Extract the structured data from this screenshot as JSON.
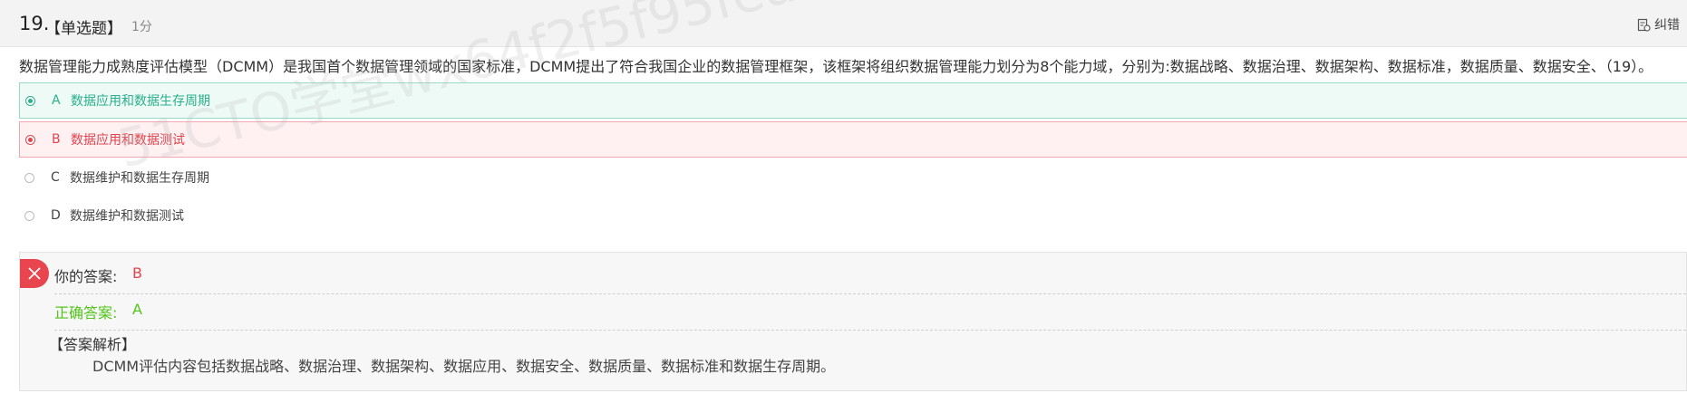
{
  "question": {
    "number": "19.",
    "type": "【单选题】",
    "score": "1分",
    "report_label": "纠错",
    "stem": "数据管理能力成熟度评估模型（DCMM）是我国首个数据管理领域的国家标准，DCMM提出了符合我国企业的数据管理框架，该框架将组织数据管理能力划分为8个能力域，分别为:数据战略、数据治理、数据架构、数据标准，数据质量、数据安全、（19）。"
  },
  "options": [
    {
      "letter": "A",
      "text": "数据应用和数据生存周期",
      "state": "correct"
    },
    {
      "letter": "B",
      "text": "数据应用和数据测试",
      "state": "wrong"
    },
    {
      "letter": "C",
      "text": "数据维护和数据生存周期",
      "state": "plain"
    },
    {
      "letter": "D",
      "text": "数据维护和数据测试",
      "state": "plain"
    }
  ],
  "watermark": "51CTO学堂wx64f2f5f95fear",
  "answer": {
    "your_label": "你的答案:",
    "your_value": "B",
    "correct_label": "正确答案:",
    "correct_value": "A",
    "analysis_title": "【答案解析】",
    "analysis_text": "DCMM评估内容包括数据战略、数据治理、数据架构、数据应用、数据安全、数据质量、数据标准和数据生存周期。"
  },
  "colors": {
    "correct": "#2ab08a",
    "wrong": "#e0444f",
    "correct_text": "#52c41a"
  },
  "icons": {
    "report": "edit-document-icon",
    "wrong_mark": "close-icon"
  }
}
